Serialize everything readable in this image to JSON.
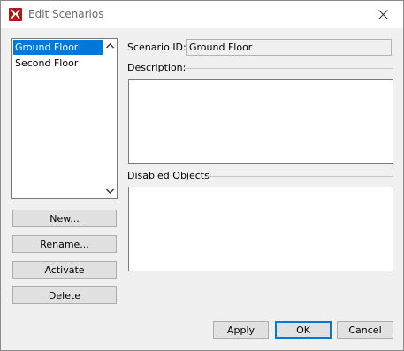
{
  "window": {
    "title": "Edit Scenarios"
  },
  "scenarios": {
    "items": [
      {
        "label": "Ground Floor",
        "selected": true
      },
      {
        "label": "Second Floor",
        "selected": false
      }
    ]
  },
  "side_buttons": {
    "new": "New...",
    "rename": "Rename...",
    "activate": "Activate",
    "delete": "Delete"
  },
  "details": {
    "scenario_id_label": "Scenario ID:",
    "scenario_id_value": "Ground Floor",
    "description_label": "Description:",
    "description_value": "",
    "disabled_objects_label": "Disabled Objects"
  },
  "footer": {
    "apply": "Apply",
    "ok": "OK",
    "cancel": "Cancel"
  },
  "colors": {
    "selection": "#0078d7",
    "app_icon": "#b01818"
  },
  "icons": {
    "app": "app-logo-icon",
    "close": "close-icon",
    "scroll_up": "chevron-up-icon",
    "scroll_down": "chevron-down-icon"
  }
}
